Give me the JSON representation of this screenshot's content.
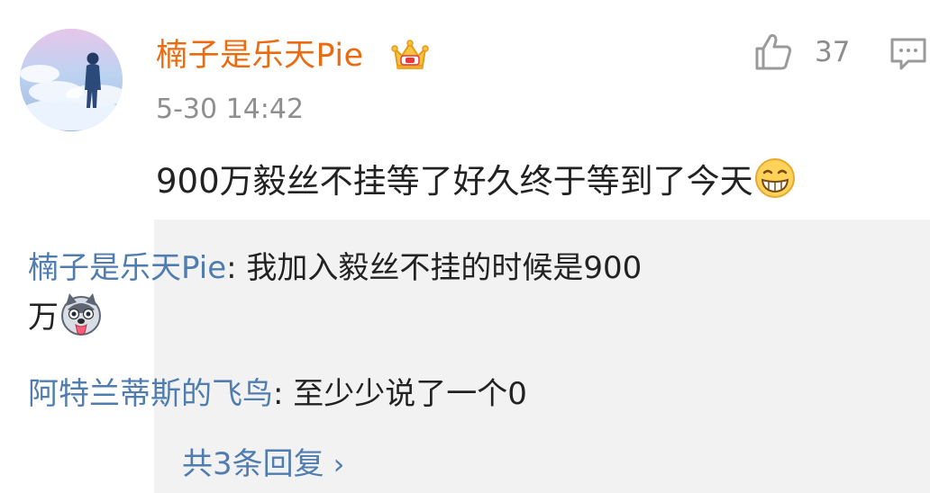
{
  "comment": {
    "username": "楠子是乐天Pie",
    "time": "5-30 14:42",
    "likes": "37",
    "text": "900万毅丝不挂等了好久终于等到了今天",
    "emoji_icon": "grin-emoji-icon",
    "badge_icon": "crown-badge-icon"
  },
  "actions": {
    "like_icon": "thumbs-up-icon",
    "reply_icon": "comment-icon"
  },
  "replies": [
    {
      "author": "楠子是乐天Pie",
      "separator": ": ",
      "text_line1": "我加入毅丝不挂的时候是900",
      "text_line2": "万",
      "emoji_icon": "husky-emoji-icon"
    },
    {
      "author": "阿特兰蒂斯的飞鸟",
      "separator": ": ",
      "text": "至少少说了一个0"
    }
  ],
  "more": {
    "label": "共3条回复",
    "chevron": "›"
  },
  "colors": {
    "username": "#eb6b10",
    "link": "#507daf",
    "muted": "#8f8f8f",
    "reply_bg": "#f2f2f2"
  }
}
